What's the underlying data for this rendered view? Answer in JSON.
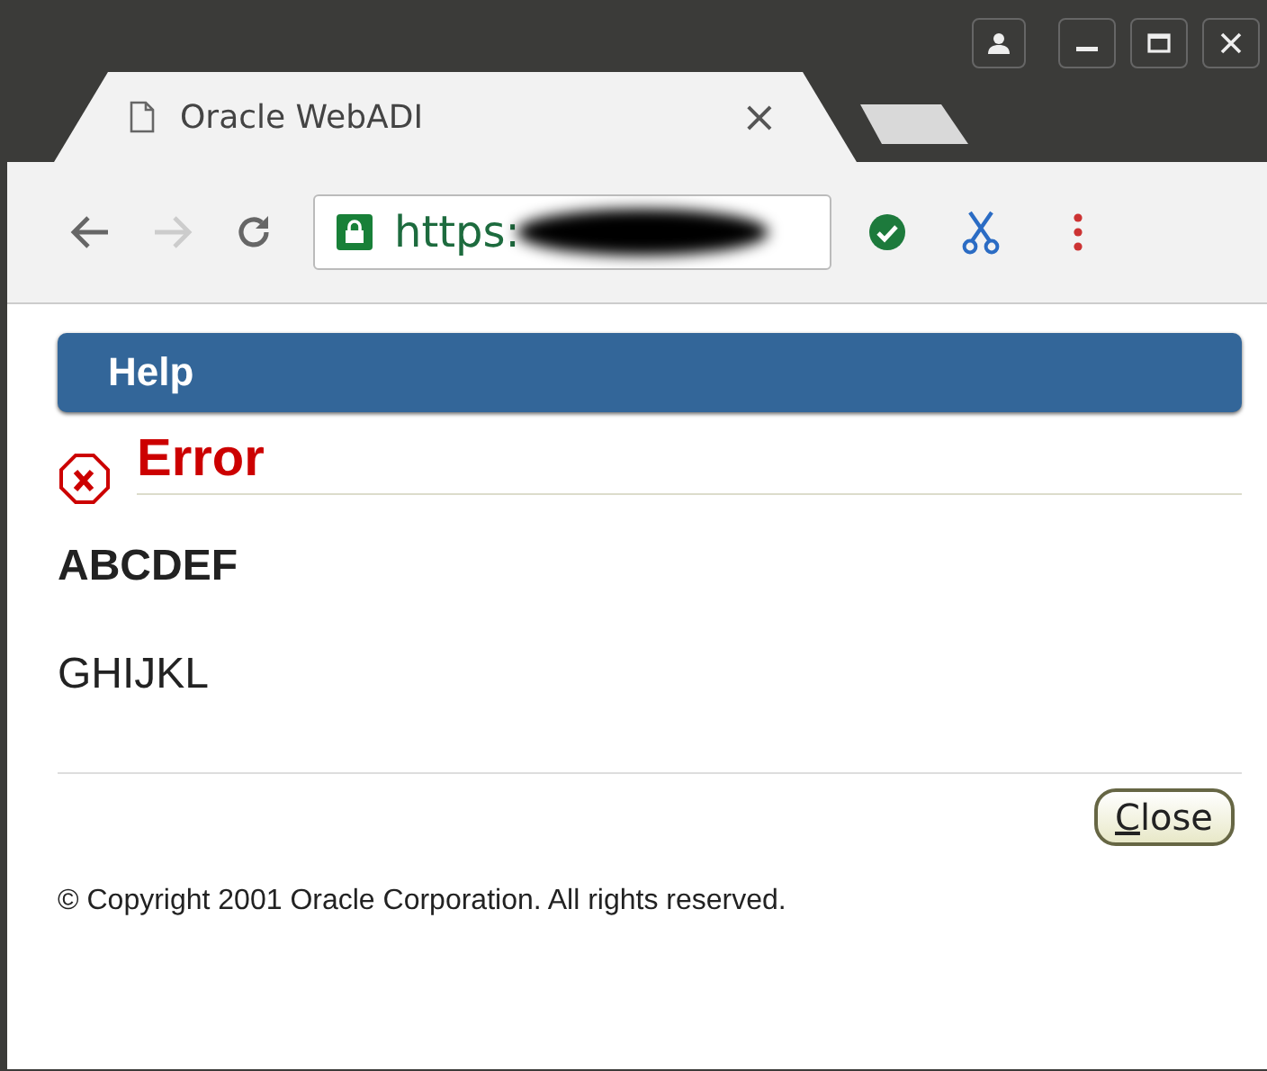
{
  "browser": {
    "tabs": [
      {
        "title": "Oracle WebADI",
        "selected": true,
        "close": "×"
      },
      {
        "selected": false
      }
    ],
    "address": {
      "text": "https:",
      "secure": true,
      "redacted": true
    }
  },
  "page": {
    "header": "Help",
    "message": {
      "kind": "error",
      "title": "Error"
    },
    "lines": [
      {
        "text": "ABCDEF",
        "bold": true
      },
      {
        "text": "GHIJKL",
        "bold": false
      }
    ],
    "buttons": [
      {
        "label": "Close",
        "first_letter_underlined": true
      }
    ],
    "footer": "© Copyright 2001 Oracle Corporation. All rights reserved."
  }
}
